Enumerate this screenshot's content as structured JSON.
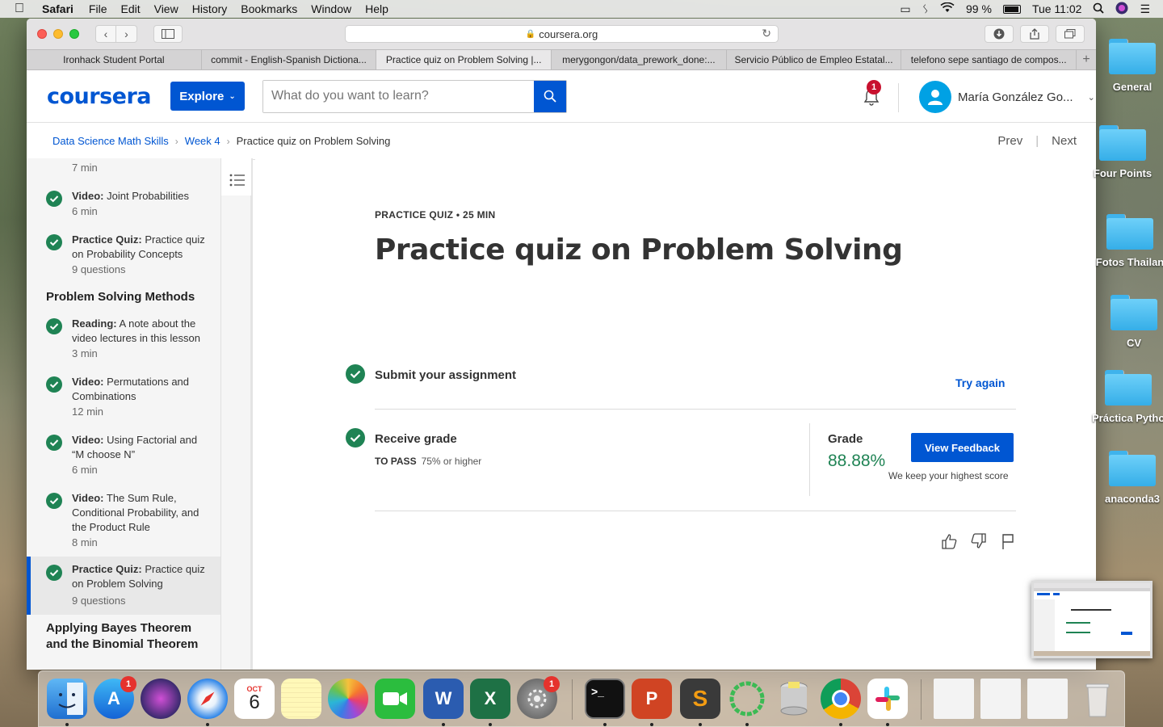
{
  "menubar": {
    "app": "Safari",
    "items": [
      "File",
      "Edit",
      "View",
      "History",
      "Bookmarks",
      "Window",
      "Help"
    ],
    "battery": "99 %",
    "clock": "Tue 11:02"
  },
  "browser": {
    "url": "coursera.org",
    "tabs": [
      "Ironhack Student Portal",
      "commit - English-Spanish Dictiona...",
      "Practice quiz on Problem Solving |...",
      "merygongon/data_prework_done:...",
      "Servicio Público de Empleo Estatal...",
      "telefono sepe santiago de compos..."
    ],
    "active_tab": 2
  },
  "header": {
    "logo": "coursera",
    "explore": "Explore",
    "search_placeholder": "What do you want to learn?",
    "notification_count": "1",
    "user_name": "María González Go..."
  },
  "breadcrumb": {
    "items": [
      "Data Science Math Skills",
      "Week 4"
    ],
    "current": "Practice quiz on Problem Solving",
    "prev": "Prev",
    "next": "Next"
  },
  "sidebar": {
    "top_duration": "7 min",
    "items": [
      {
        "kind": "Video:",
        "title": "Joint Probabilities",
        "sub": "6 min"
      },
      {
        "kind": "Practice Quiz:",
        "title": "Practice quiz on Probability Concepts",
        "sub": "9 questions"
      },
      {
        "kind": "Reading:",
        "title": "A note about the video lectures in this lesson",
        "sub": "3 min"
      },
      {
        "kind": "Video:",
        "title": "Permutations and Combinations",
        "sub": "12 min"
      },
      {
        "kind": "Video:",
        "title": "Using Factorial and “M choose N”",
        "sub": "6 min"
      },
      {
        "kind": "Video:",
        "title": "The Sum Rule, Conditional Probability, and the Product Rule",
        "sub": "8 min"
      },
      {
        "kind": "Practice Quiz:",
        "title": "Practice quiz on Problem Solving",
        "sub": "9 questions"
      }
    ],
    "section_problem_solving": "Problem Solving Methods",
    "section_bayes": "Applying Bayes Theorem and the Binomial Theorem"
  },
  "quiz": {
    "eyebrow": "PRACTICE QUIZ • 25 MIN",
    "title": "Practice quiz on Problem Solving",
    "submit_label": "Submit your assignment",
    "try_again": "Try again",
    "receive_grade": "Receive grade",
    "to_pass_label": "TO PASS",
    "to_pass_value": "75% or higher",
    "grade_heading": "Grade",
    "grade_value": "88.88%",
    "view_feedback": "View Feedback",
    "keep_note": "We keep your highest score"
  },
  "desktop": {
    "folders": [
      "General",
      "Four Points",
      "Fotos Thailan",
      "CV",
      "Práctica Pytho",
      "anaconda3"
    ]
  },
  "dock": {
    "appstore_badge": "1",
    "calendar_month": "OCT",
    "calendar_day": "6",
    "settings_badge": "1"
  },
  "colors": {
    "brand": "#0056d2",
    "success": "#1f8354",
    "badge": "#c8102e"
  }
}
